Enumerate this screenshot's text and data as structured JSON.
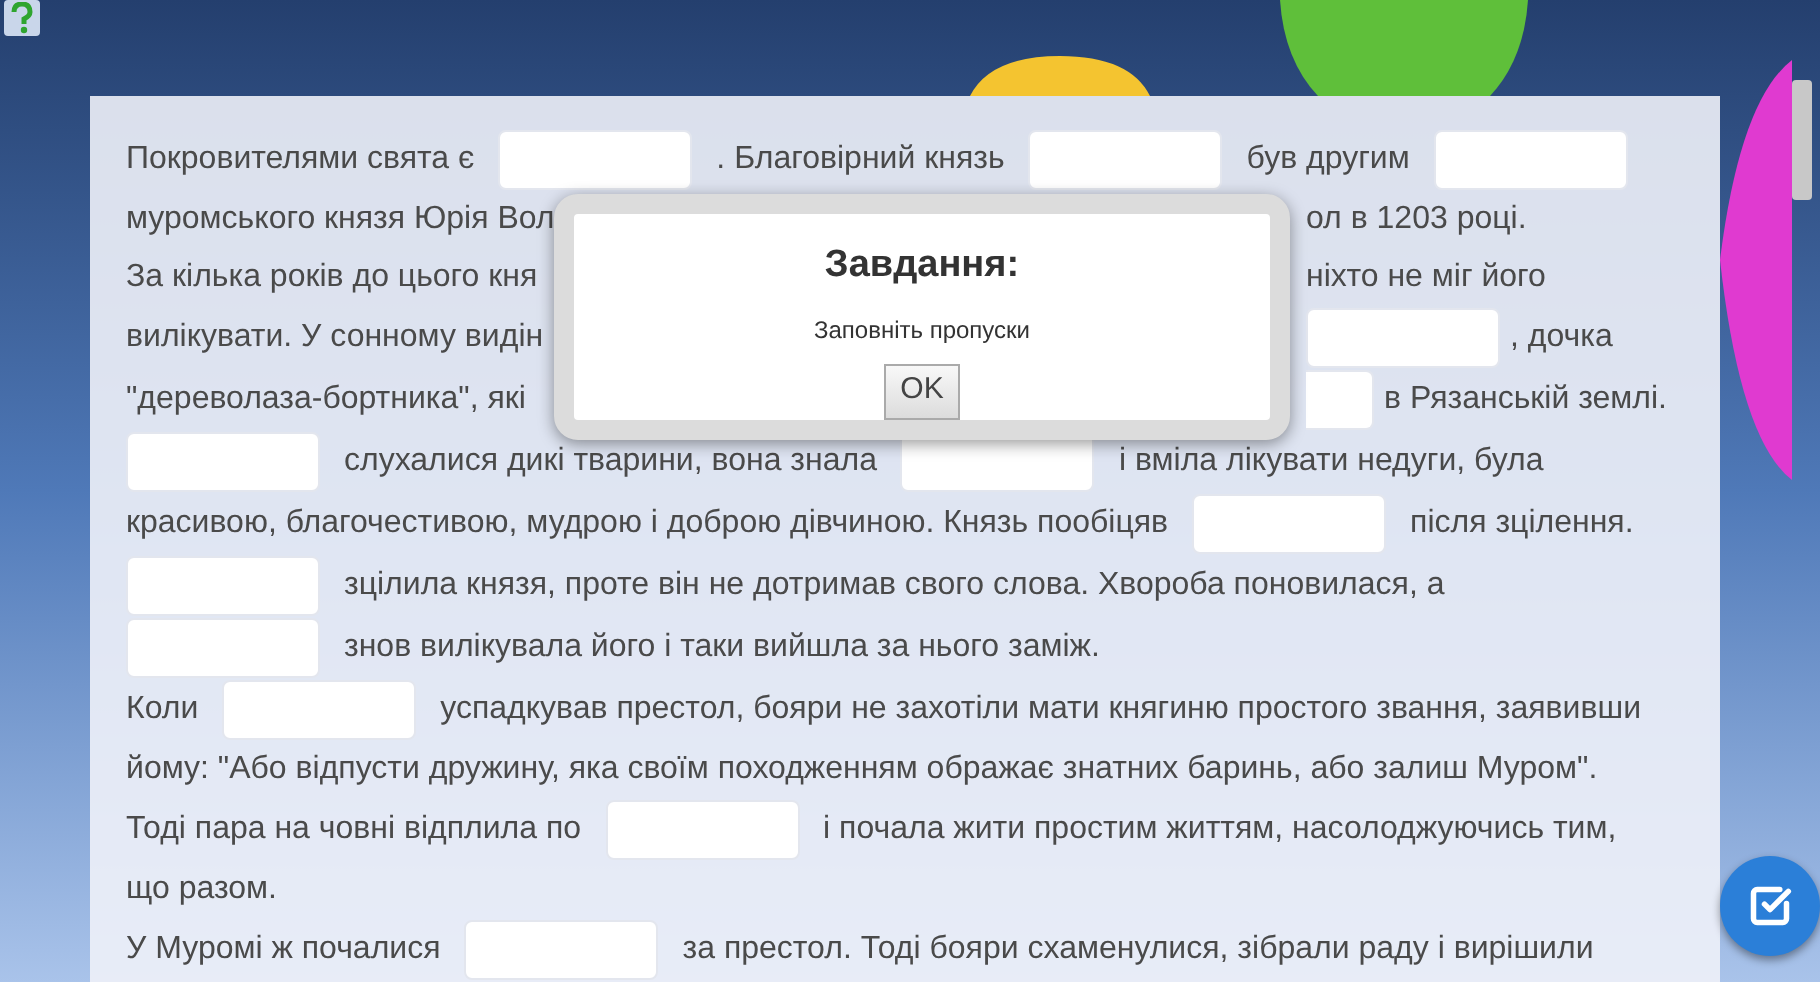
{
  "text_lines": [
    {
      "left": [
        {
          "kind": "text",
          "text": "Покровителями свята є"
        },
        {
          "kind": "blank"
        },
        {
          "kind": "text",
          "text": ". Благовірний князь"
        },
        {
          "kind": "blank"
        },
        {
          "kind": "text",
          "text": "був другим"
        },
        {
          "kind": "blank"
        }
      ]
    },
    {
      "left": [
        {
          "kind": "text",
          "text": "муромського князя Юрія Вол"
        }
      ],
      "right": [
        {
          "kind": "text",
          "text": "ол в 1203 році."
        }
      ]
    },
    {
      "left": [
        {
          "kind": "text",
          "text": "За кілька років до цього кня"
        }
      ],
      "right": [
        {
          "kind": "text",
          "text": "ніхто не міг його"
        }
      ]
    },
    {
      "left": [
        {
          "kind": "text",
          "text": "вилікувати. У сонному видін"
        }
      ],
      "right": [
        {
          "kind": "blank"
        },
        {
          "kind": "text",
          "text": ", дочка"
        }
      ]
    },
    {
      "left": [
        {
          "kind": "text",
          "text": "\"дереволаза-бортника\", які"
        }
      ],
      "right": [
        {
          "kind": "part_blank"
        },
        {
          "kind": "text",
          "text": "в Рязанській землі."
        }
      ]
    },
    {
      "left": [
        {
          "kind": "blank"
        },
        {
          "kind": "text",
          "text": "слухалися дикі тварини, вона знала"
        },
        {
          "kind": "blank"
        },
        {
          "kind": "text",
          "text": "і вміла лікувати недуги, була"
        }
      ]
    },
    {
      "left": [
        {
          "kind": "text",
          "text": "красивою, благочестивою, мудрою і доброю дівчиною. Князь пообіцяв"
        },
        {
          "kind": "blank"
        },
        {
          "kind": "text",
          "text": "після зцілення."
        }
      ]
    },
    {
      "left": [
        {
          "kind": "blank"
        },
        {
          "kind": "text",
          "text": "зцілила князя, проте він не дотримав свого слова. Хвороба поновилася, а"
        }
      ]
    },
    {
      "left": [
        {
          "kind": "blank"
        },
        {
          "kind": "text",
          "text": "знов вилікувала його і таки вийшла за нього заміж."
        }
      ]
    },
    {
      "left": [
        {
          "kind": "text",
          "text": "Коли"
        },
        {
          "kind": "blank"
        },
        {
          "kind": "text",
          "text": "успадкував престол, бояри не захотіли мати княгиню простого звання, заявивши"
        }
      ]
    },
    {
      "left": [
        {
          "kind": "text",
          "text": "йому: \"Або відпусти дружину, яка своїм походженням ображає знатних баринь, або залиш Муром\"."
        }
      ]
    },
    {
      "left": [
        {
          "kind": "text",
          "text": "Тоді пара на човні відплила по"
        },
        {
          "kind": "blank"
        },
        {
          "kind": "text",
          "text": "і почала жити простим життям, насолоджуючись тим,"
        }
      ]
    },
    {
      "left": [
        {
          "kind": "text",
          "text": "що разом."
        }
      ]
    },
    {
      "left": [
        {
          "kind": "text",
          "text": "У Муромі ж почалися"
        },
        {
          "kind": "blank"
        },
        {
          "kind": "text",
          "text": "за престол. Тоді бояри схаменулися, зібрали раду і вирішили"
        }
      ]
    }
  ],
  "dialog": {
    "title": "Завдання:",
    "message": "Заповніть пропуски",
    "button": "OK"
  }
}
